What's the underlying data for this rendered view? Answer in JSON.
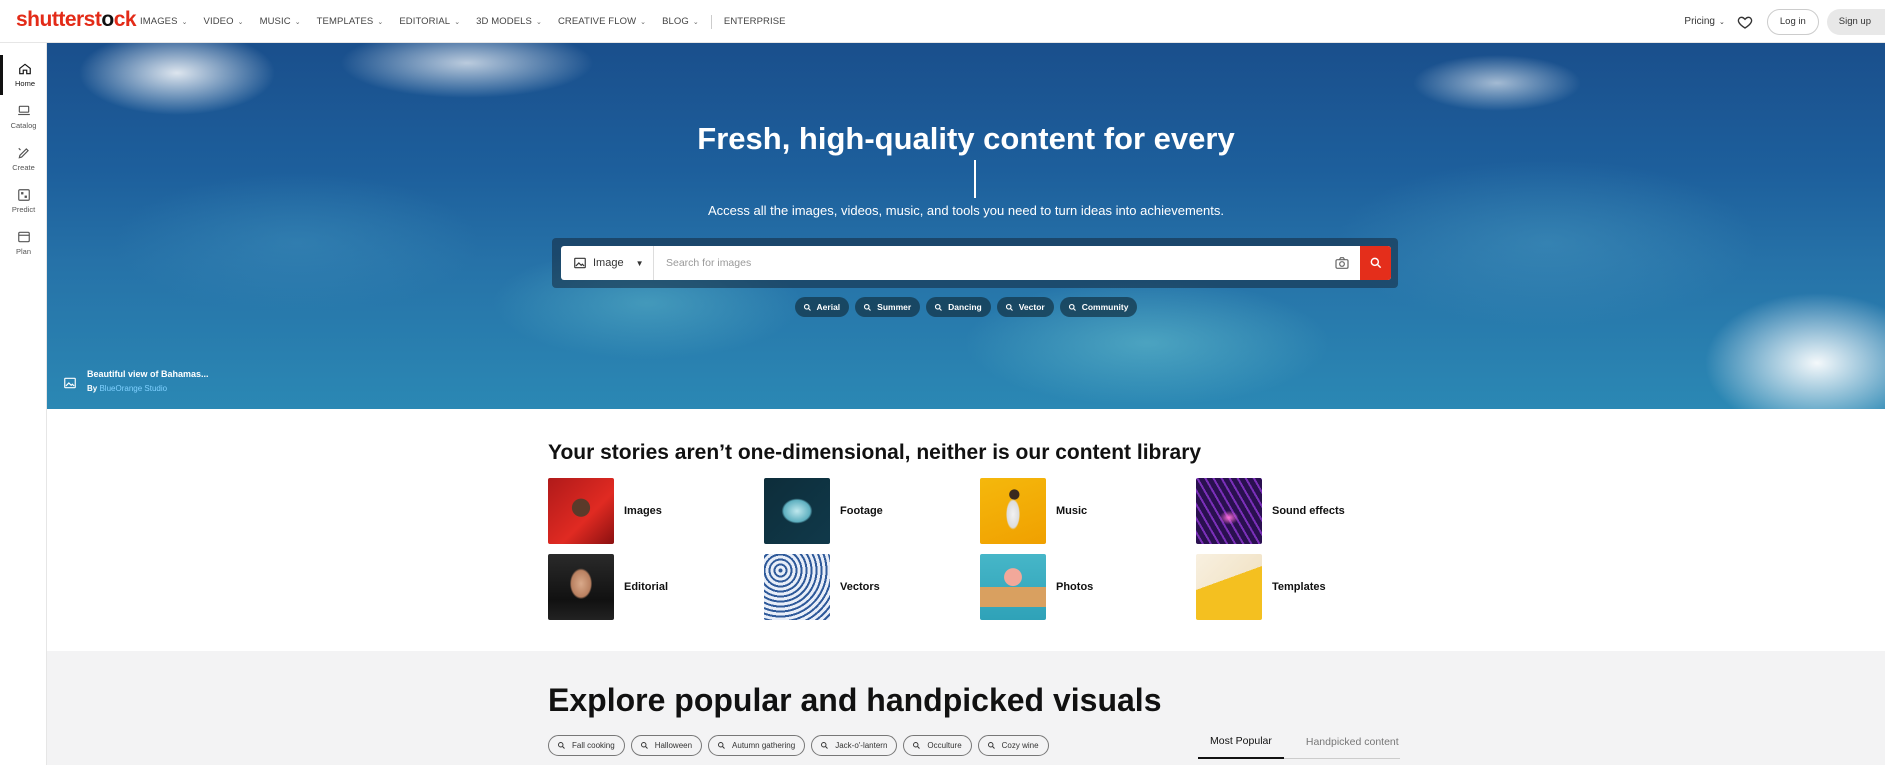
{
  "brand": {
    "logo_part1": "shutterst",
    "logo_part2": "o",
    "logo_part3": "ck",
    "accent": "#e42e1b"
  },
  "topnav": {
    "items": [
      {
        "label": "IMAGES",
        "dropdown": true
      },
      {
        "label": "VIDEO",
        "dropdown": true
      },
      {
        "label": "MUSIC",
        "dropdown": true
      },
      {
        "label": "TEMPLATES",
        "dropdown": true
      },
      {
        "label": "EDITORIAL",
        "dropdown": true
      },
      {
        "label": "3D MODELS",
        "dropdown": true
      },
      {
        "label": "CREATIVE FLOW",
        "dropdown": true
      },
      {
        "label": "BLOG",
        "dropdown": true
      }
    ],
    "enterprise": "ENTERPRISE",
    "pricing": "Pricing",
    "login": "Log in",
    "signup": "Sign up"
  },
  "sidebar": {
    "items": [
      {
        "label": "Home",
        "icon": "home-icon",
        "active": true
      },
      {
        "label": "Catalog",
        "icon": "catalog-icon",
        "active": false
      },
      {
        "label": "Create",
        "icon": "create-icon",
        "active": false
      },
      {
        "label": "Predict",
        "icon": "predict-icon",
        "active": false
      },
      {
        "label": "Plan",
        "icon": "plan-icon",
        "active": false
      }
    ]
  },
  "hero": {
    "title": "Fresh, high-quality content for every",
    "subtitle": "Access all the images, videos, music, and tools you need to turn ideas into achievements.",
    "search_type": "Image",
    "search_placeholder": "Search for images",
    "chips": [
      "Aerial",
      "Summer",
      "Dancing",
      "Vector",
      "Community"
    ],
    "credit_title": "Beautiful view of Bahamas...",
    "credit_by": "By",
    "credit_author": "BlueOrange Studio"
  },
  "library": {
    "title": "Your stories aren’t one-dimensional, neither is our content library",
    "items": [
      {
        "label": "Images"
      },
      {
        "label": "Footage"
      },
      {
        "label": "Music"
      },
      {
        "label": "Sound effects"
      },
      {
        "label": "Editorial"
      },
      {
        "label": "Vectors"
      },
      {
        "label": "Photos"
      },
      {
        "label": "Templates"
      }
    ]
  },
  "explore": {
    "title": "Explore popular and handpicked visuals",
    "tags": [
      "Fall cooking",
      "Halloween",
      "Autumn gathering",
      "Jack-o'-lantern",
      "Occulture",
      "Cozy wine"
    ],
    "tabs": [
      {
        "label": "Most Popular",
        "active": true
      },
      {
        "label": "Handpicked content",
        "active": false
      }
    ]
  }
}
